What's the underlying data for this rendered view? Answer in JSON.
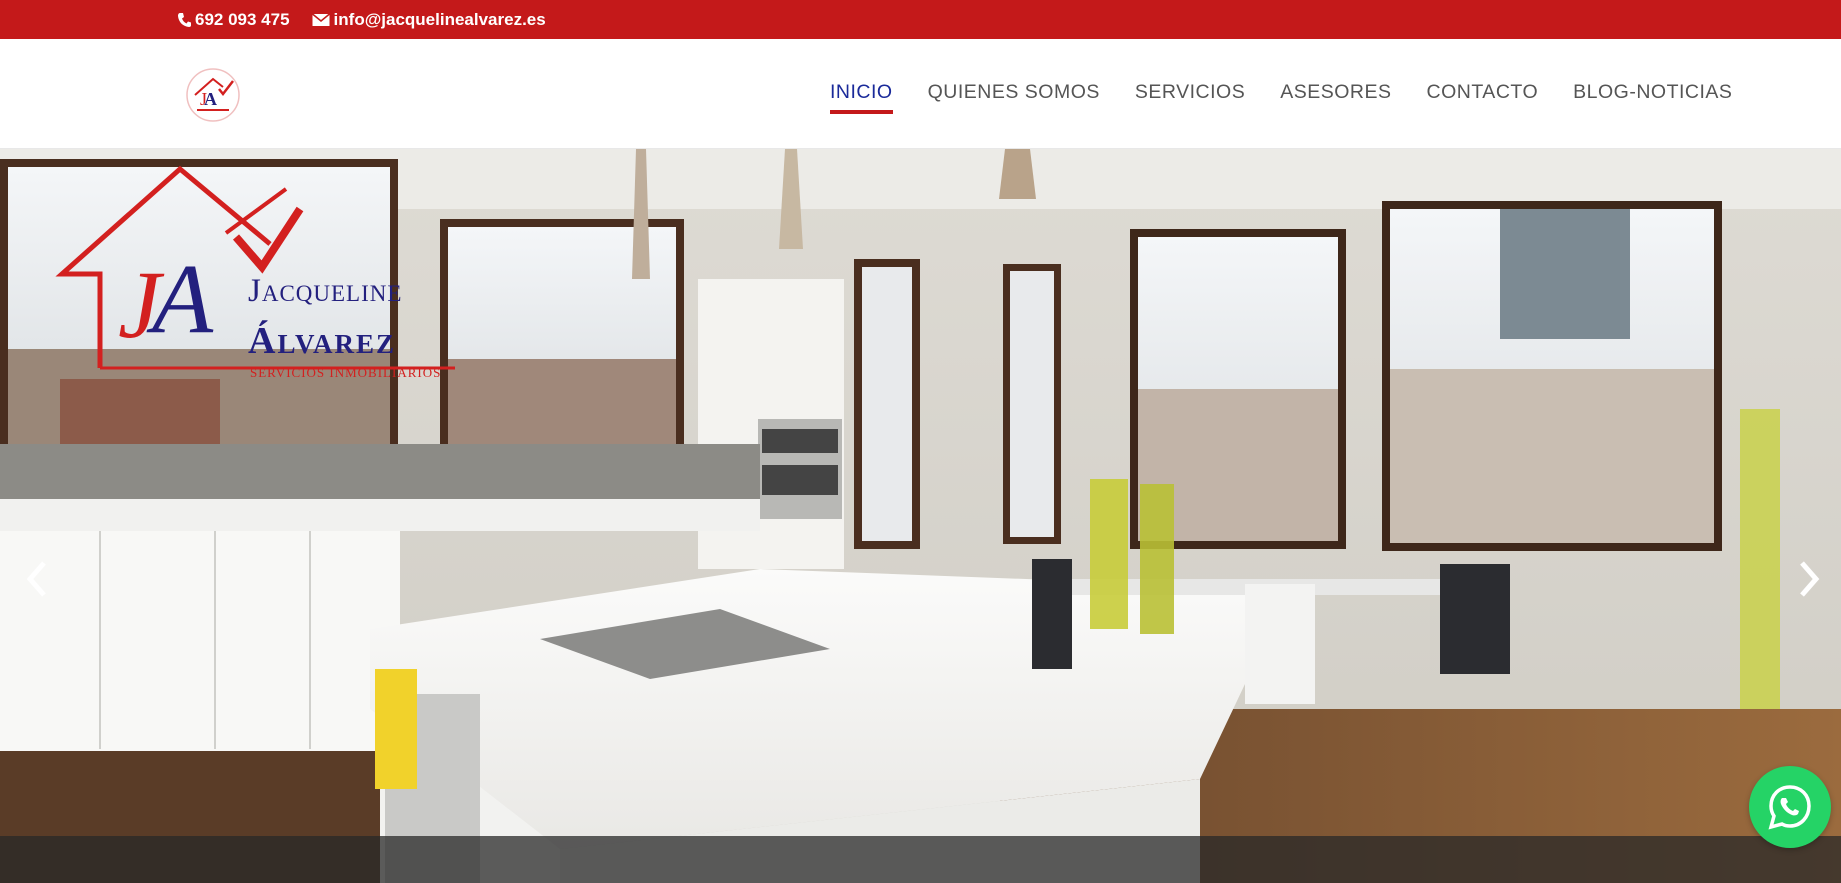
{
  "topbar": {
    "phone": "692 093 475",
    "email": "info@jacquelinealvarez.es",
    "background": "#c4191a"
  },
  "header": {
    "logo_icon": "ja-house-logo-icon",
    "nav": [
      {
        "label": "INICIO",
        "active": true
      },
      {
        "label": "QUIENES SOMOS",
        "active": false
      },
      {
        "label": "SERVICIOS",
        "active": false
      },
      {
        "label": "ASESORES",
        "active": false
      },
      {
        "label": "CONTACTO",
        "active": false
      },
      {
        "label": "BLOG-NOTICIAS",
        "active": false
      }
    ],
    "active_color": "#1a2a9a",
    "underline_color": "#c4191a"
  },
  "hero": {
    "logo": {
      "line1": "Jacqueline",
      "line2": "Álvarez",
      "line3": "SERVICIOS INMOBILIARIOS",
      "monogram": "JA"
    },
    "prev_icon": "chevron-left-icon",
    "next_icon": "chevron-right-icon"
  },
  "whatsapp": {
    "icon": "whatsapp-icon",
    "color": "#25d366"
  }
}
